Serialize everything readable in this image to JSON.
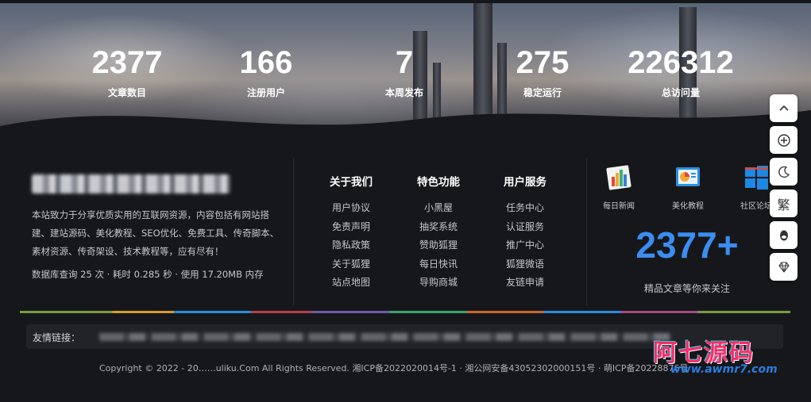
{
  "stats": [
    {
      "value": "2377",
      "label": "文章数目"
    },
    {
      "value": "166",
      "label": "注册用户"
    },
    {
      "value": "7",
      "label": "本周发布"
    },
    {
      "value": "275",
      "label": "稳定运行"
    },
    {
      "value": "226312",
      "label": "总访问量"
    }
  ],
  "about": {
    "description": "本站致力于分享优质实用的互联网资源，内容包括有网站搭建、建站源码、美化教程、SEO优化、免费工具、传奇脚本、素材资源、传奇架设、技术教程等，应有尽有！",
    "meta": "数据库查询 25 次 · 耗时 0.285 秒 · 使用 17.20MB 内存"
  },
  "columns": [
    {
      "title": "关于我们",
      "links": [
        "用户协议",
        "免责声明",
        "隐私政策",
        "关于狐狸",
        "站点地图"
      ]
    },
    {
      "title": "特色功能",
      "links": [
        "小黑屋",
        "抽奖系统",
        "赞助狐狸",
        "每日快讯",
        "导购商城"
      ]
    },
    {
      "title": "用户服务",
      "links": [
        "任务中心",
        "认证服务",
        "推广中心",
        "狐狸微语",
        "友链申请"
      ]
    }
  ],
  "apps": [
    {
      "label": "每日新闻",
      "icon": "bar-chart-icon"
    },
    {
      "label": "美化教程",
      "icon": "pie-chart-icon"
    },
    {
      "label": "社区论坛",
      "icon": "windows-icon"
    }
  ],
  "highlight": {
    "count": "2377+",
    "subtitle": "精品文章等你来关注"
  },
  "friends": {
    "label": "友情链接："
  },
  "copyright": "Copyright © 2022 - 20……uliku.Com All Rights Reserved. 湘ICP备2022020014号-1 · 湘公网安备43052302000151号 · 萌ICP备20228876号",
  "watermark": {
    "cn": "阿七源码",
    "url": "www.awmr7.com"
  },
  "side_buttons": [
    {
      "name": "back-to-top-button",
      "icon": "chevron-up-icon"
    },
    {
      "name": "add-button",
      "icon": "plus-circle-icon"
    },
    {
      "name": "dark-mode-button",
      "icon": "moon-icon"
    },
    {
      "name": "traditional-chinese-button",
      "icon": "text",
      "text": "繁"
    },
    {
      "name": "qq-button",
      "icon": "qq-icon"
    },
    {
      "name": "vip-button",
      "icon": "diamond-icon"
    }
  ],
  "colors": {
    "accent": "#3b8df2",
    "background": "#16171a"
  }
}
